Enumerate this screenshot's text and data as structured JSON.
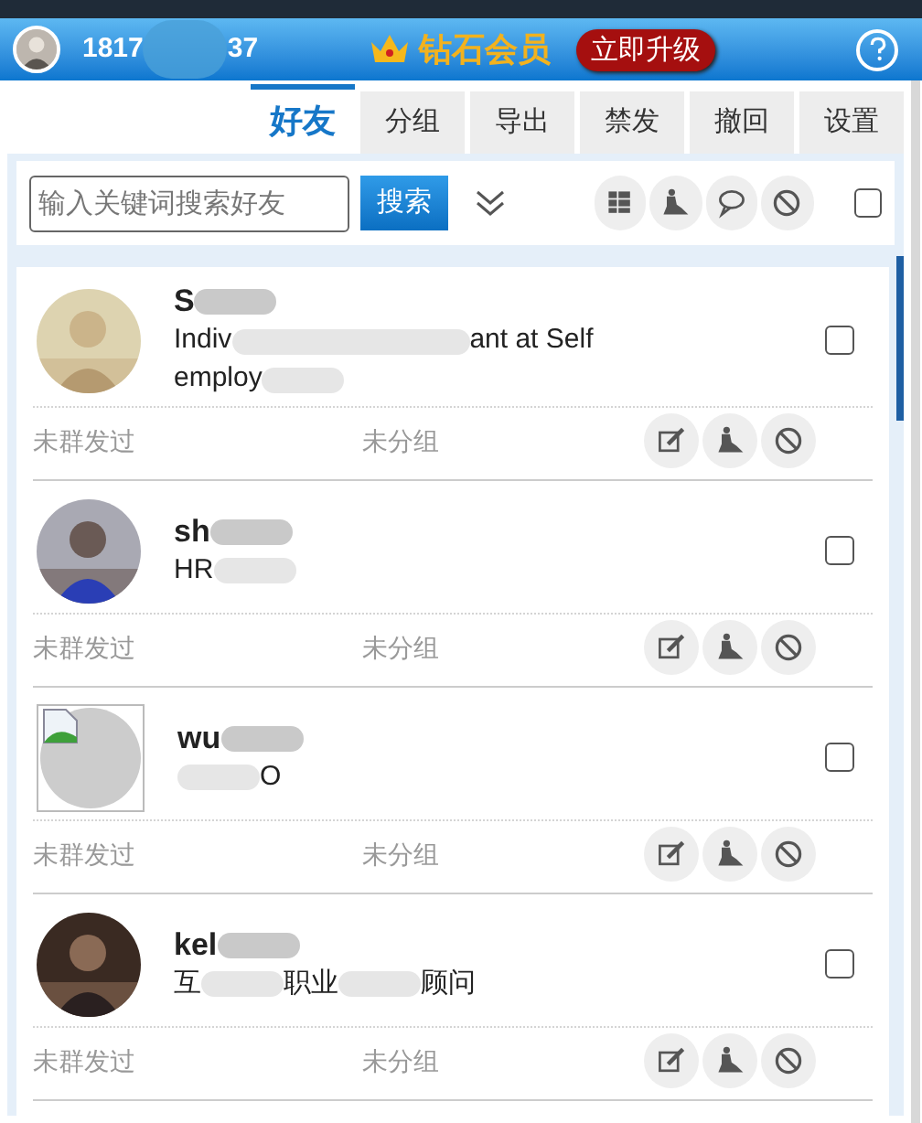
{
  "header": {
    "phone": [
      {
        "text": "1817"
      },
      {
        "kind": "blur"
      },
      {
        "text": "37"
      }
    ],
    "badge": "钻石会员",
    "upgrade_button": "立即升级"
  },
  "tabs": [
    {
      "label": "好友",
      "selected": true
    },
    {
      "label": "分组",
      "selected": false
    },
    {
      "label": "导出",
      "selected": false
    },
    {
      "label": "禁发",
      "selected": false
    },
    {
      "label": "撤回",
      "selected": false
    },
    {
      "label": "设置",
      "selected": false
    }
  ],
  "search": {
    "placeholder": "输入关键词搜索好友",
    "button": "搜索"
  },
  "select_all": {
    "checked": false
  },
  "friends": [
    {
      "avatar": {
        "kind": "picture"
      },
      "name": [
        {
          "text": "S"
        },
        {
          "kind": "blur"
        }
      ],
      "headline": [
        [
          {
            "text": "Indiv"
          },
          {
            "kind": "blur"
          },
          {
            "text": "ant at Self"
          }
        ],
        [
          {
            "text": "employ"
          },
          {
            "kind": "blur"
          }
        ]
      ],
      "status": "未群发过",
      "group": "未分组",
      "checked": false
    },
    {
      "avatar": {
        "kind": "picture"
      },
      "name": [
        {
          "text": "sh"
        },
        {
          "kind": "blur"
        }
      ],
      "headline": [
        [
          {
            "text": "HR"
          },
          {
            "kind": "blur"
          }
        ]
      ],
      "status": "未群发过",
      "group": "未分组",
      "checked": false
    },
    {
      "avatar": {
        "kind": "broken-image"
      },
      "name": [
        {
          "text": "wu"
        },
        {
          "kind": "blur"
        }
      ],
      "headline": [
        [
          {
            "kind": "blur"
          },
          {
            "text": "O"
          }
        ]
      ],
      "status": "未群发过",
      "group": "未分组",
      "checked": false
    },
    {
      "avatar": {
        "kind": "picture"
      },
      "name": [
        {
          "text": "kel"
        },
        {
          "kind": "blur"
        }
      ],
      "headline": [
        [
          {
            "text": "互"
          },
          {
            "kind": "blur"
          },
          {
            "text": "职业"
          },
          {
            "kind": "blur"
          },
          {
            "text": "顾问"
          }
        ]
      ],
      "status": "未群发过",
      "group": "未分组",
      "checked": false
    }
  ]
}
